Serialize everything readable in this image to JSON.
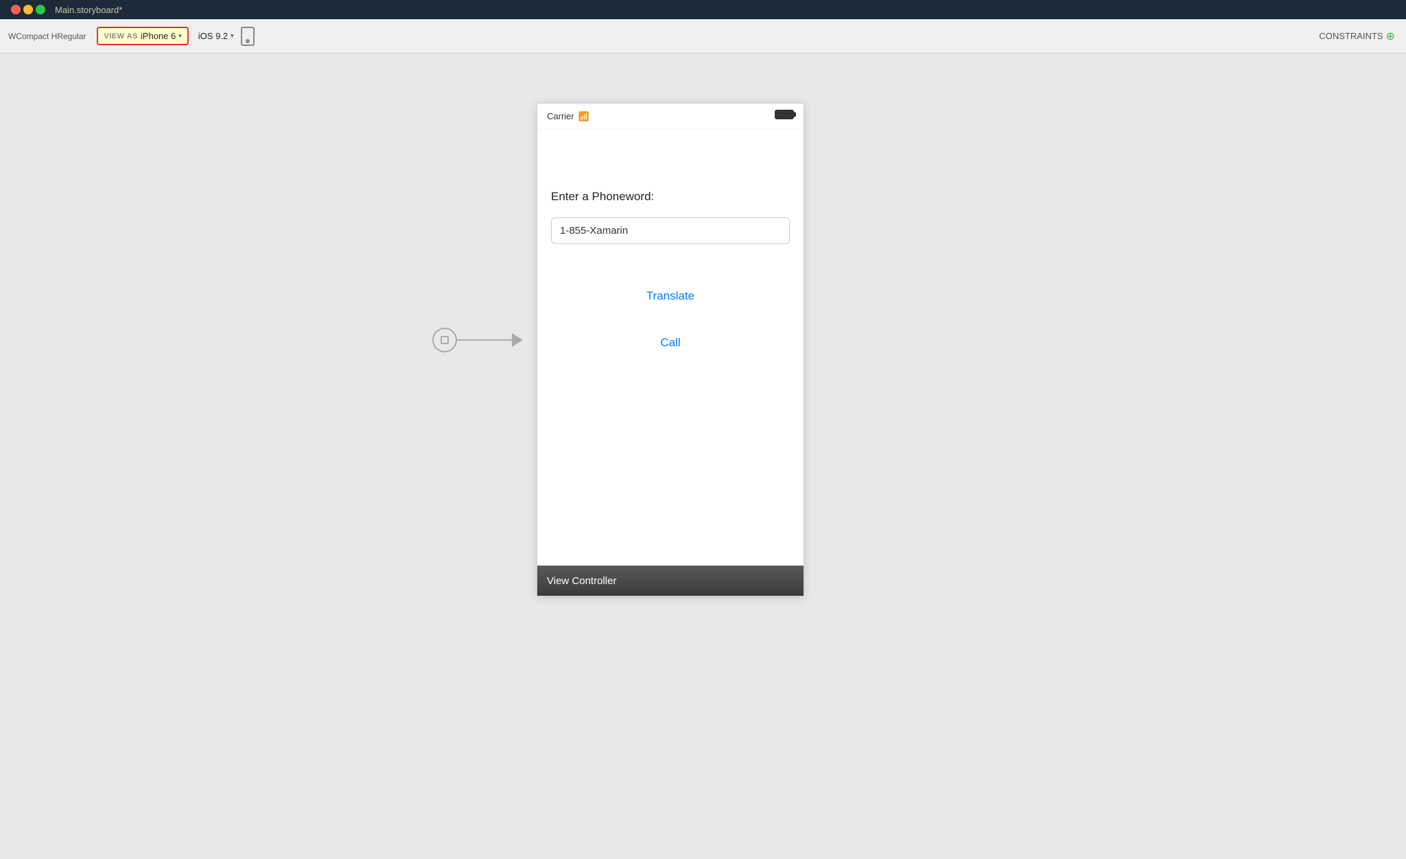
{
  "titleBar": {
    "title": "Main.storyboard*"
  },
  "toolbar": {
    "sizeClasses": "WCompact HRegular",
    "viewAsLabel": "VIEW AS",
    "deviceName": "iPhone 6",
    "iosVersion": "iOS 9.2",
    "constraintsLabel": "CONSTRAINTS"
  },
  "statusBar": {
    "carrier": "Carrier",
    "wifiIcon": "📶"
  },
  "iphone": {
    "promptLabel": "Enter a Phoneword:",
    "inputValue": "1-855-Xamarin",
    "inputPlaceholder": "1-855-Xamarin",
    "translateLabel": "Translate",
    "callLabel": "Call"
  },
  "viewController": {
    "label": "View Controller"
  }
}
